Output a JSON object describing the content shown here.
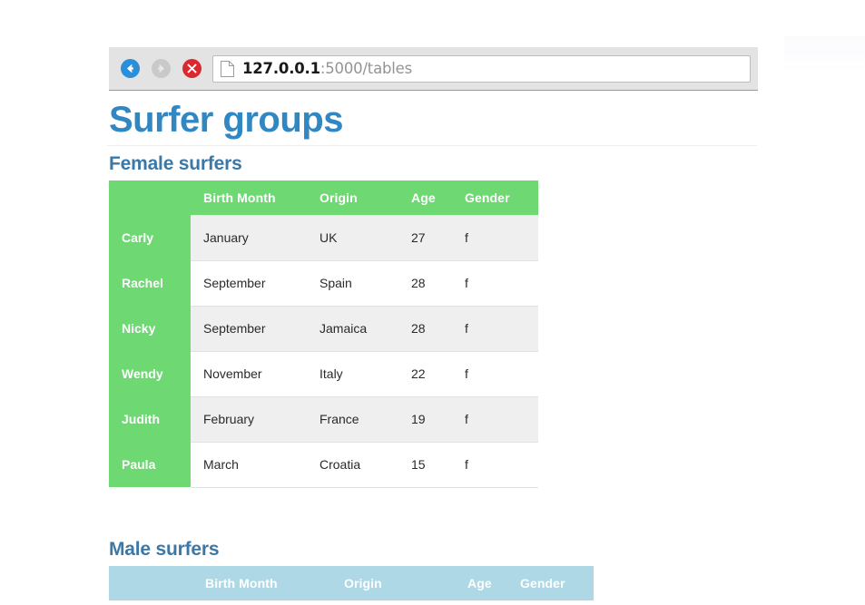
{
  "browser": {
    "back_icon": "back-arrow-icon",
    "forward_icon": "forward-arrow-icon",
    "stop_icon": "stop-x-icon",
    "page_icon": "page-document-icon",
    "url_host": "127.0.0.1",
    "url_path": ":5000/tables",
    "url_full": "127.0.0.1:5000/tables"
  },
  "page": {
    "title": "Surfer groups"
  },
  "colors": {
    "title_blue": "#3087c2",
    "heading_blue": "#3a78a8",
    "female_green": "#6ed873",
    "male_blue": "#aed8e5",
    "stripe_gray": "#efefef",
    "row_white": "#ffffff"
  },
  "sections": [
    {
      "heading": "Female surfers",
      "theme": "green",
      "columns": [
        "",
        "Birth Month",
        "Origin",
        "Age",
        "Gender"
      ],
      "rows": [
        {
          "name": "Carly",
          "birth_month": "January",
          "origin": "UK",
          "age": "27",
          "gender": "f"
        },
        {
          "name": "Rachel",
          "birth_month": "September",
          "origin": "Spain",
          "age": "28",
          "gender": "f"
        },
        {
          "name": "Nicky",
          "birth_month": "September",
          "origin": "Jamaica",
          "age": "28",
          "gender": "f"
        },
        {
          "name": "Wendy",
          "birth_month": "November",
          "origin": "Italy",
          "age": "22",
          "gender": "f"
        },
        {
          "name": "Judith",
          "birth_month": "February",
          "origin": "France",
          "age": "19",
          "gender": "f"
        },
        {
          "name": "Paula",
          "birth_month": "March",
          "origin": "Croatia",
          "age": "15",
          "gender": "f"
        }
      ]
    },
    {
      "heading": "Male surfers",
      "theme": "blue",
      "columns": [
        "",
        "Birth Month",
        "Origin",
        "Age",
        "Gender"
      ],
      "rows": []
    }
  ]
}
